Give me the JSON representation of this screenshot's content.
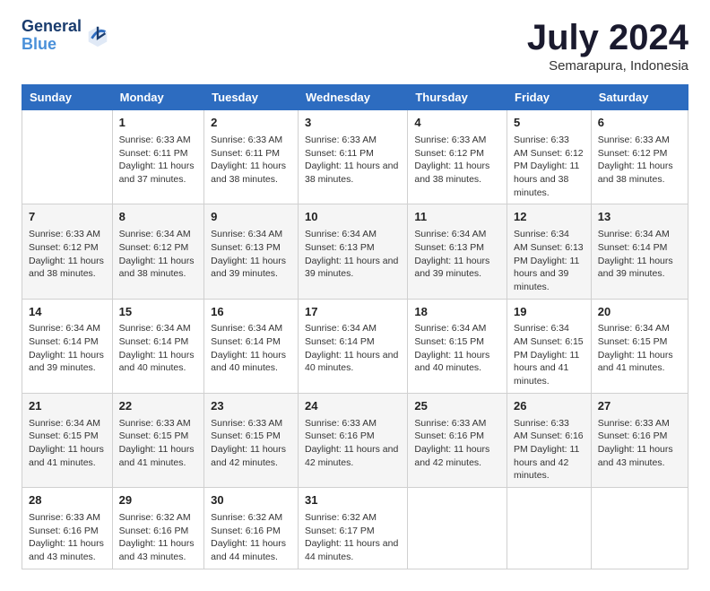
{
  "logo": {
    "line1": "General",
    "line2": "Blue"
  },
  "title": "July 2024",
  "subtitle": "Semarapura, Indonesia",
  "days": [
    "Sunday",
    "Monday",
    "Tuesday",
    "Wednesday",
    "Thursday",
    "Friday",
    "Saturday"
  ],
  "weeks": [
    [
      {
        "day": "",
        "info": ""
      },
      {
        "day": "1",
        "info": "Sunrise: 6:33 AM\nSunset: 6:11 PM\nDaylight: 11 hours and 37 minutes."
      },
      {
        "day": "2",
        "info": "Sunrise: 6:33 AM\nSunset: 6:11 PM\nDaylight: 11 hours and 38 minutes."
      },
      {
        "day": "3",
        "info": "Sunrise: 6:33 AM\nSunset: 6:11 PM\nDaylight: 11 hours and 38 minutes."
      },
      {
        "day": "4",
        "info": "Sunrise: 6:33 AM\nSunset: 6:12 PM\nDaylight: 11 hours and 38 minutes."
      },
      {
        "day": "5",
        "info": "Sunrise: 6:33 AM\nSunset: 6:12 PM\nDaylight: 11 hours and 38 minutes."
      },
      {
        "day": "6",
        "info": "Sunrise: 6:33 AM\nSunset: 6:12 PM\nDaylight: 11 hours and 38 minutes."
      }
    ],
    [
      {
        "day": "7",
        "info": ""
      },
      {
        "day": "8",
        "info": "Sunrise: 6:34 AM\nSunset: 6:12 PM\nDaylight: 11 hours and 38 minutes."
      },
      {
        "day": "9",
        "info": "Sunrise: 6:34 AM\nSunset: 6:13 PM\nDaylight: 11 hours and 39 minutes."
      },
      {
        "day": "10",
        "info": "Sunrise: 6:34 AM\nSunset: 6:13 PM\nDaylight: 11 hours and 39 minutes."
      },
      {
        "day": "11",
        "info": "Sunrise: 6:34 AM\nSunset: 6:13 PM\nDaylight: 11 hours and 39 minutes."
      },
      {
        "day": "12",
        "info": "Sunrise: 6:34 AM\nSunset: 6:13 PM\nDaylight: 11 hours and 39 minutes."
      },
      {
        "day": "13",
        "info": "Sunrise: 6:34 AM\nSunset: 6:14 PM\nDaylight: 11 hours and 39 minutes."
      }
    ],
    [
      {
        "day": "14",
        "info": ""
      },
      {
        "day": "15",
        "info": "Sunrise: 6:34 AM\nSunset: 6:14 PM\nDaylight: 11 hours and 40 minutes."
      },
      {
        "day": "16",
        "info": "Sunrise: 6:34 AM\nSunset: 6:14 PM\nDaylight: 11 hours and 40 minutes."
      },
      {
        "day": "17",
        "info": "Sunrise: 6:34 AM\nSunset: 6:14 PM\nDaylight: 11 hours and 40 minutes."
      },
      {
        "day": "18",
        "info": "Sunrise: 6:34 AM\nSunset: 6:15 PM\nDaylight: 11 hours and 40 minutes."
      },
      {
        "day": "19",
        "info": "Sunrise: 6:34 AM\nSunset: 6:15 PM\nDaylight: 11 hours and 41 minutes."
      },
      {
        "day": "20",
        "info": "Sunrise: 6:34 AM\nSunset: 6:15 PM\nDaylight: 11 hours and 41 minutes."
      }
    ],
    [
      {
        "day": "21",
        "info": ""
      },
      {
        "day": "22",
        "info": "Sunrise: 6:33 AM\nSunset: 6:15 PM\nDaylight: 11 hours and 41 minutes."
      },
      {
        "day": "23",
        "info": "Sunrise: 6:33 AM\nSunset: 6:15 PM\nDaylight: 11 hours and 42 minutes."
      },
      {
        "day": "24",
        "info": "Sunrise: 6:33 AM\nSunset: 6:16 PM\nDaylight: 11 hours and 42 minutes."
      },
      {
        "day": "25",
        "info": "Sunrise: 6:33 AM\nSunset: 6:16 PM\nDaylight: 11 hours and 42 minutes."
      },
      {
        "day": "26",
        "info": "Sunrise: 6:33 AM\nSunset: 6:16 PM\nDaylight: 11 hours and 42 minutes."
      },
      {
        "day": "27",
        "info": "Sunrise: 6:33 AM\nSunset: 6:16 PM\nDaylight: 11 hours and 43 minutes."
      }
    ],
    [
      {
        "day": "28",
        "info": "Sunrise: 6:33 AM\nSunset: 6:16 PM\nDaylight: 11 hours and 43 minutes."
      },
      {
        "day": "29",
        "info": "Sunrise: 6:32 AM\nSunset: 6:16 PM\nDaylight: 11 hours and 43 minutes."
      },
      {
        "day": "30",
        "info": "Sunrise: 6:32 AM\nSunset: 6:16 PM\nDaylight: 11 hours and 44 minutes."
      },
      {
        "day": "31",
        "info": "Sunrise: 6:32 AM\nSunset: 6:17 PM\nDaylight: 11 hours and 44 minutes."
      },
      {
        "day": "",
        "info": ""
      },
      {
        "day": "",
        "info": ""
      },
      {
        "day": "",
        "info": ""
      }
    ]
  ],
  "week1_day7_info": "Sunrise: 6:33 AM\nSunset: 6:12 PM\nDaylight: 11 hours and 38 minutes.",
  "week3_day14_info": "Sunrise: 6:34 AM\nSunset: 6:14 PM\nDaylight: 11 hours and 39 minutes.",
  "week4_day21_info": "Sunrise: 6:34 AM\nSunset: 6:15 PM\nDaylight: 11 hours and 41 minutes."
}
